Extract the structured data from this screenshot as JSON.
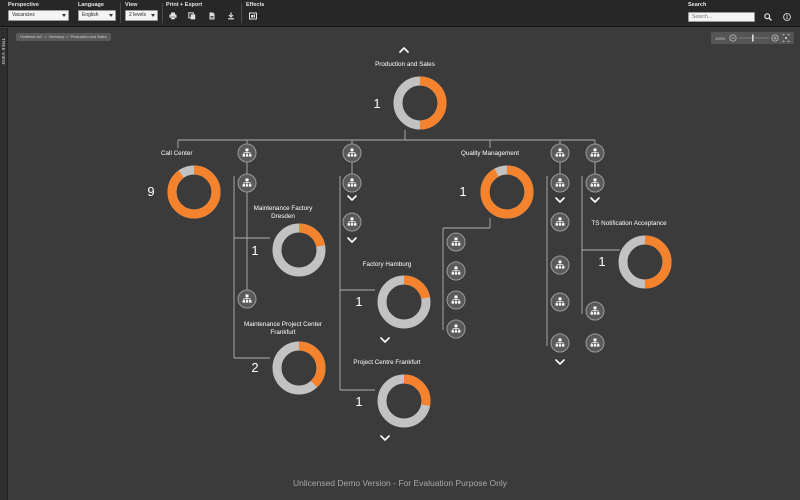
{
  "toolbar": {
    "perspective": {
      "label": "Perspective",
      "value": "Vacancies"
    },
    "language": {
      "label": "Language",
      "value": "English"
    },
    "view": {
      "label": "View",
      "value": "2 levels"
    },
    "print_export": {
      "label": "Print + Export",
      "icons": [
        "print-icon",
        "copy-icon",
        "pdf-icon",
        "download-icon"
      ]
    },
    "effects": {
      "label": "Effects",
      "icons": [
        "effects-icon"
      ]
    },
    "search": {
      "label": "Search",
      "placeholder": "Search..."
    },
    "right_icons": [
      "search-icon",
      "info-icon"
    ]
  },
  "sidebar": {
    "label": "TREE VIEW"
  },
  "breadcrumb": [
    "Holdernix AG",
    "Germany",
    "Production and Sales"
  ],
  "zoom": {
    "value": "100%"
  },
  "colors": {
    "accent": "#f5822d",
    "ring_gray": "#c2c2c2",
    "background": "#3b3b3b",
    "connector": "#b0b0b0"
  },
  "nodes": [
    {
      "id": "root",
      "title": [
        "Production and Sales"
      ],
      "count": "1",
      "fraction": 0.5
    },
    {
      "id": "call-center",
      "title": [
        "Call Center"
      ],
      "count": "9",
      "fraction": 0.9
    },
    {
      "id": "maintenance-factory-dresden",
      "title": [
        "Maintenance Factory",
        "Dresden"
      ],
      "count": "1",
      "fraction": 0.22
    },
    {
      "id": "maintenance-project-center-frankfurt",
      "title": [
        "Maintenance Project Center",
        "Frankfurt"
      ],
      "count": "2",
      "fraction": 0.38
    },
    {
      "id": "factory-hamburg",
      "title": [
        "Factory Hamburg"
      ],
      "count": "1",
      "fraction": 0.22
    },
    {
      "id": "project-centre-frankfurt",
      "title": [
        "Project Centre Frankfurt"
      ],
      "count": "1",
      "fraction": 0.28
    },
    {
      "id": "quality-management",
      "title": [
        "Quality Management"
      ],
      "count": "1",
      "fraction": 0.92
    },
    {
      "id": "ts-notification-acceptance",
      "title": [
        "TS Notification Acceptance"
      ],
      "count": "1",
      "fraction": 0.5
    }
  ],
  "watermark": "Unlicensed Demo Version - For Evaluation Purpose Only"
}
